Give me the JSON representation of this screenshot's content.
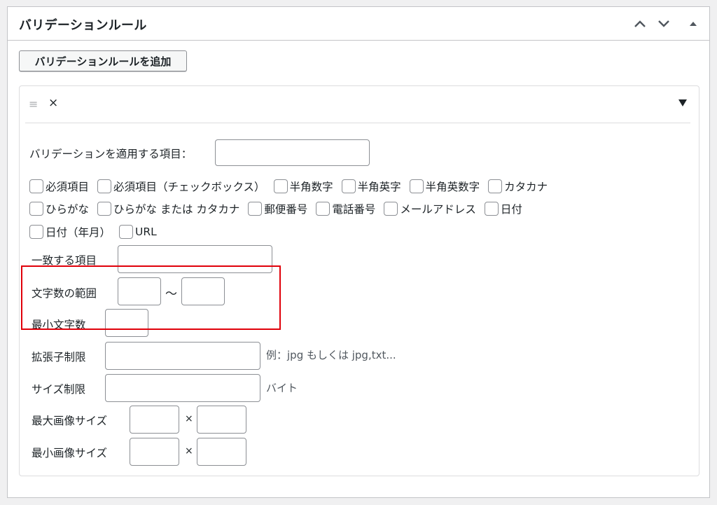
{
  "metabox": {
    "title": "バリデーションルール",
    "controls": [
      "chevron-up-icon",
      "chevron-down-icon",
      "triangle-up-icon"
    ]
  },
  "add_button": "バリデーションルールを追加",
  "rule": {
    "drag_icon": "≡",
    "remove_label": "×",
    "target_label": "バリデーションを適用する項目：",
    "checkboxes_row1": [
      "必須項目",
      "必須項目（チェックボックス）",
      "半角数字",
      "半角英字",
      "半角英数字",
      "カタカナ"
    ],
    "checkboxes_row2": [
      "ひらがな",
      "ひらがな または カタカナ",
      "郵便番号",
      "電話番号",
      "メールアドレス",
      "日付"
    ],
    "checkboxes_row3": [
      "日付（年月）",
      "URL"
    ],
    "match_label": "一致する項目",
    "char_range_label": "文字数の範囲",
    "range_sep": "〜",
    "min_chars_label": "最小文字数",
    "ext_label": "拡張子制限",
    "ext_hint": "例：jpg もしくは jpg,txt...",
    "size_label": "サイズ制限",
    "size_hint": "バイト",
    "max_image_label": "最大画像サイズ",
    "min_image_label": "最小画像サイズ",
    "times": "×"
  },
  "colors": {
    "highlight": "#e0000a",
    "border": "#8c8f94",
    "background": "#f0f0f1"
  }
}
